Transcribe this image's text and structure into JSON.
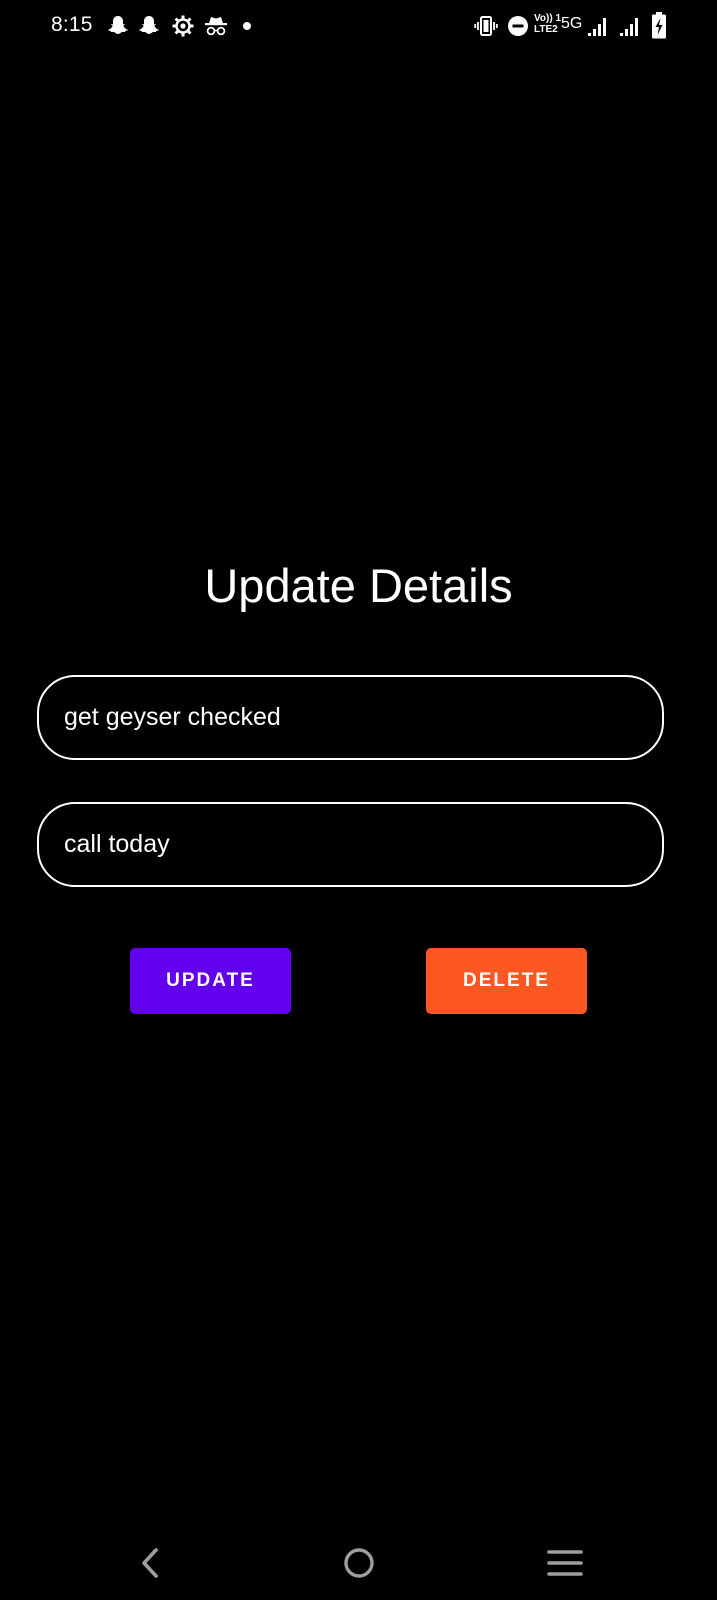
{
  "status_bar": {
    "time": "8:15",
    "left_icons": [
      "snapchat-icon",
      "snapchat-icon",
      "settings-gear-icon",
      "incognito-icon",
      "notification-dot-icon"
    ],
    "right_icons": [
      "vibrate-icon",
      "do-not-disturb-icon",
      "volte-icon",
      "signal-icon",
      "signal-icon",
      "battery-charging-icon"
    ],
    "volte_line1": "Vo)) 1",
    "volte_line2": "LTE2",
    "network_type": "5G"
  },
  "main": {
    "title": "Update Details",
    "title_field": {
      "value": "get geyser checked"
    },
    "description_field": {
      "value": "call today"
    },
    "update_label": "UPDATE",
    "delete_label": "DELETE"
  },
  "nav_bar": {
    "icons": [
      "back-icon",
      "home-icon",
      "menu-icon"
    ]
  },
  "colors": {
    "background": "#000000",
    "update_button": "#6200EE",
    "delete_button": "#FF5722",
    "text": "#FFFFFF"
  }
}
